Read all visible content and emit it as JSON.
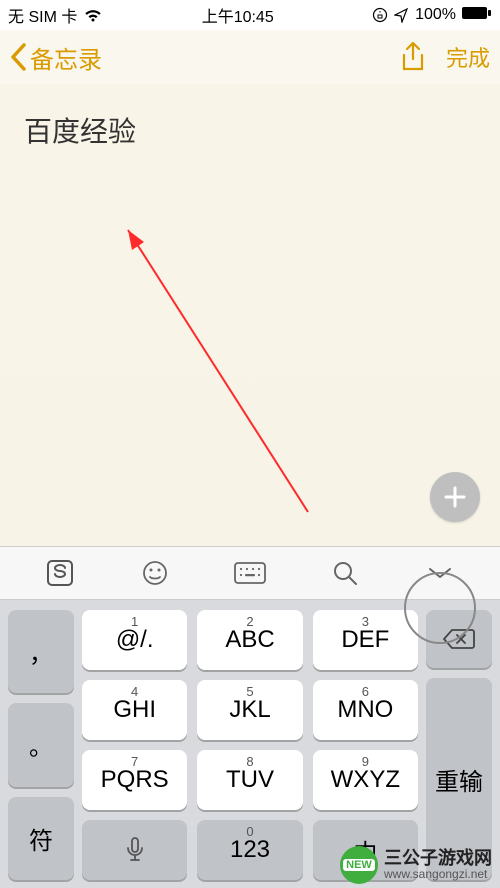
{
  "status": {
    "carrier": "无 SIM 卡",
    "time": "上午10:45",
    "battery_pct": "100%"
  },
  "nav": {
    "back_label": "备忘录",
    "done_label": "完成"
  },
  "note": {
    "content": "百度经验"
  },
  "keyboard": {
    "left": {
      "comma": "，",
      "period": "。",
      "symbol": "符"
    },
    "grid": [
      {
        "sub": "1",
        "main": "@/."
      },
      {
        "sub": "2",
        "main": "ABC"
      },
      {
        "sub": "3",
        "main": "DEF"
      },
      {
        "sub": "4",
        "main": "GHI"
      },
      {
        "sub": "5",
        "main": "JKL"
      },
      {
        "sub": "6",
        "main": "MNO"
      },
      {
        "sub": "7",
        "main": "PQRS"
      },
      {
        "sub": "8",
        "main": "TUV"
      },
      {
        "sub": "9",
        "main": "WXYZ"
      },
      {
        "sub": "",
        "main": "mic"
      },
      {
        "sub": "0",
        "main": "123"
      },
      {
        "sub": "",
        "main": "中"
      }
    ],
    "right": {
      "reenter": "重输"
    }
  },
  "watermark": {
    "main": "三公子游戏网",
    "sub": "www.sangongzi.net",
    "badge": "NEW"
  },
  "colors": {
    "accent": "#d99b00"
  }
}
